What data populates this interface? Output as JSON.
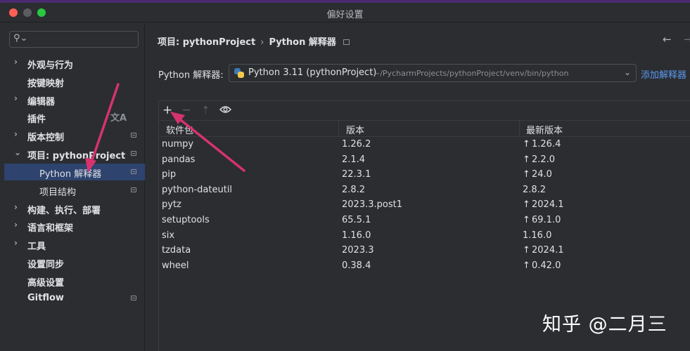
{
  "window": {
    "title": "偏好设置"
  },
  "search": {
    "placeholder": "",
    "value": ""
  },
  "sidebar": {
    "items": [
      {
        "label": "外观与行为",
        "chevron": "›"
      },
      {
        "label": "按键映射"
      },
      {
        "label": "编辑器",
        "chevron": "›"
      },
      {
        "label": "插件"
      },
      {
        "label": "版本控制",
        "chevron": "›"
      },
      {
        "label": "项目: pythonProject",
        "chevron": "⌄"
      },
      {
        "label": "Python 解释器"
      },
      {
        "label": "项目结构"
      },
      {
        "label": "构建、执行、部署",
        "chevron": "›"
      },
      {
        "label": "语言和框架",
        "chevron": "›"
      },
      {
        "label": "工具",
        "chevron": "›"
      },
      {
        "label": "设置同步"
      },
      {
        "label": "高级设置"
      },
      {
        "label": "Gitflow"
      }
    ],
    "plugin_icon": "translate-icon"
  },
  "breadcrumb": {
    "parent": "项目: pythonProject",
    "separator": "›",
    "current": "Python 解释器"
  },
  "interpreter": {
    "label": "Python 解释器:",
    "name": "Python 3.11 (pythonProject)",
    "path": "~/PycharmProjects/pythonProject/venv/bin/python",
    "add_link": "添加解释器"
  },
  "toolbar": {
    "add": "+",
    "remove": "−",
    "upgrade": "⇡"
  },
  "packages": {
    "headers": [
      "软件包",
      "版本",
      "最新版本"
    ],
    "rows": [
      {
        "name": "numpy",
        "version": "1.26.2",
        "latest": "1.26.4",
        "upgrade": true
      },
      {
        "name": "pandas",
        "version": "2.1.4",
        "latest": "2.2.0",
        "upgrade": true
      },
      {
        "name": "pip",
        "version": "22.3.1",
        "latest": "24.0",
        "upgrade": true
      },
      {
        "name": "python-dateutil",
        "version": "2.8.2",
        "latest": "2.8.2",
        "upgrade": false
      },
      {
        "name": "pytz",
        "version": "2023.3.post1",
        "latest": "2024.1",
        "upgrade": true
      },
      {
        "name": "setuptools",
        "version": "65.5.1",
        "latest": "69.1.0",
        "upgrade": true
      },
      {
        "name": "six",
        "version": "1.16.0",
        "latest": "1.16.0",
        "upgrade": false
      },
      {
        "name": "tzdata",
        "version": "2023.3",
        "latest": "2024.1",
        "upgrade": true
      },
      {
        "name": "wheel",
        "version": "0.38.4",
        "latest": "0.42.0",
        "upgrade": true
      }
    ],
    "upgrade_glyph": "↑"
  },
  "watermark": "知乎 @二月三",
  "colors": {
    "background": "#2b2d30",
    "selection": "#2e436e",
    "link": "#5c98f0",
    "annotation_arrow": "#d6336c"
  }
}
